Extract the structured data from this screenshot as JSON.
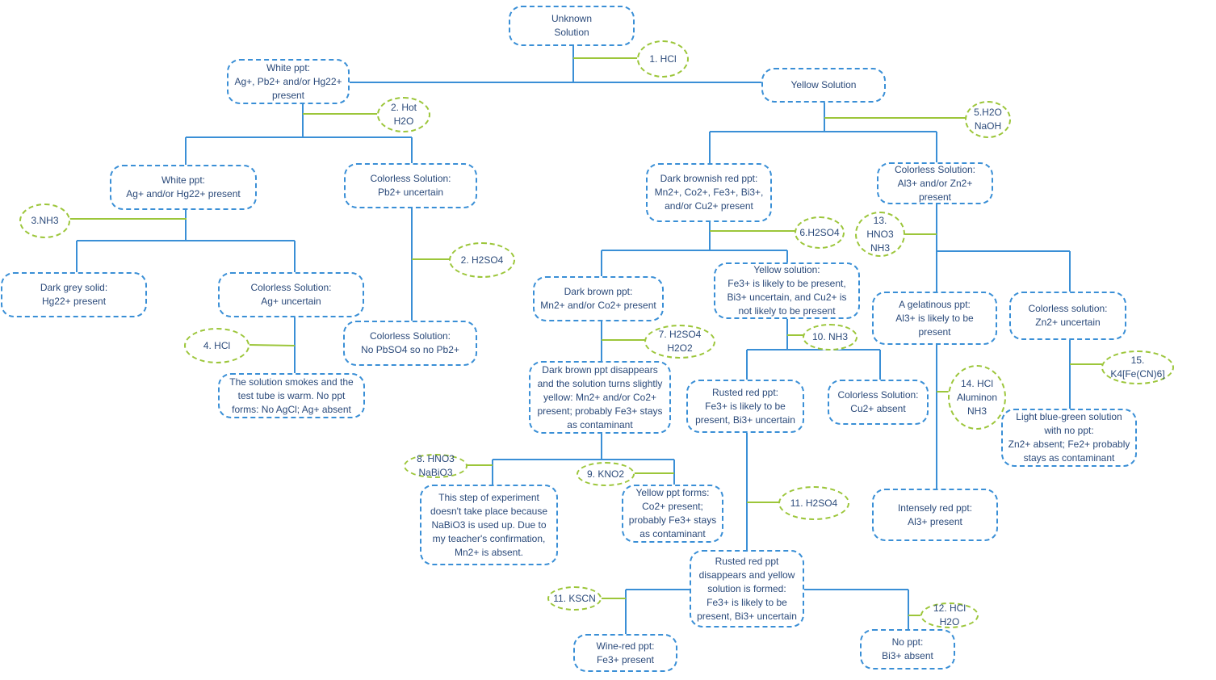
{
  "colors": {
    "node_border": "#3a8fd6",
    "reagent_border": "#9cc63a",
    "text": "#2b4a7a",
    "tree_line": "#3a8fd6",
    "reagent_line": "#9cc63a"
  },
  "nodes": {
    "unknown": "Unknown\nSolution",
    "white_ppt": "White ppt:\nAg+, Pb2+ and/or Hg22+\npresent",
    "yellow_solution": "Yellow Solution",
    "white_ppt_ag_hg": "White ppt:\nAg+ and/or Hg22+ present",
    "colorless_pb_uncertain": "Colorless Solution:\nPb2+ uncertain",
    "dark_grey_solid": "Dark grey solid:\nHg22+ present",
    "colorless_ag_uncertain": "Colorless Solution:\nAg+ uncertain",
    "colorless_no_pbso4": "Colorless Solution:\nNo PbSO4 so no Pb2+",
    "smokes": "The solution smokes and the\ntest tube is warm. No ppt\nforms: No AgCl; Ag+ absent",
    "dark_brownish_red": "Dark brownish red ppt:\nMn2+, Co2+, Fe3+, Bi3+,\nand/or Cu2+ present",
    "colorless_al_zn": "Colorless Solution:\nAl3+ and/or Zn2+\npresent",
    "dark_brown_ppt": "Dark brown ppt:\nMn2+ and/or Co2+ present",
    "yellow_solution_fe": "Yellow solution:\nFe3+ is likely to be present,\nBi3+ uncertain, and Cu2+ is\nnot likely to be present",
    "gelatinous": "A gelatinous ppt:\nAl3+ is likely to be\npresent",
    "colorless_zn_uncertain": "Colorless solution:\nZn2+ uncertain",
    "dark_brown_disappears": "Dark brown ppt disappears\nand the solution turns slightly\nyellow: Mn2+ and/or Co2+\npresent; probably Fe3+ stays\nas contaminant",
    "rusted_red_ppt": "Rusted red ppt:\nFe3+ is likely to be\npresent, Bi3+ uncertain",
    "colorless_cu_absent": "Colorless Solution:\nCu2+ absent",
    "light_blue_green": "Light blue-green solution\nwith no ppt:\nZn2+ absent; Fe2+ probably\nstays as contaminant",
    "step_not_taken": "This step of experiment\ndoesn't take place because\nNaBiO3 is used up. Due to\nmy teacher's confirmation,\nMn2+ is absent.",
    "yellow_ppt_co": "Yellow ppt forms:\nCo2+ present;\nprobably Fe3+ stays\nas contaminant",
    "intensely_red": "Intensely red ppt:\nAl3+ present",
    "rusted_red_disappears": "Rusted red ppt\ndisappears and yellow\nsolution is formed:\nFe3+ is likely to be\npresent, Bi3+ uncertain",
    "wine_red": "Wine-red ppt:\nFe3+ present",
    "no_ppt_bi": "No ppt:\nBi3+ absent"
  },
  "reagents": {
    "r1": "1. HCl",
    "r2": "2. Hot\nH2O",
    "r3": "3.NH3",
    "r2b": "2. H2SO4",
    "r4": "4. HCl",
    "r5": "5.H2O\nNaOH",
    "r6": "6.H2SO4",
    "r13": "13.\nHNO3\nNH3",
    "r7": "7. H2SO4\nH2O2",
    "r10": "10. NH3",
    "r14": "14. HCl\nAluminon\nNH3",
    "r15": "15.\nK4[Fe(CN)6]",
    "r8": "8. HNO3\nNaBiO3",
    "r9": "9. KNO2",
    "r11": "11. H2SO4",
    "r11b": "11. KSCN",
    "r12": "12. HCl\nH2O"
  }
}
